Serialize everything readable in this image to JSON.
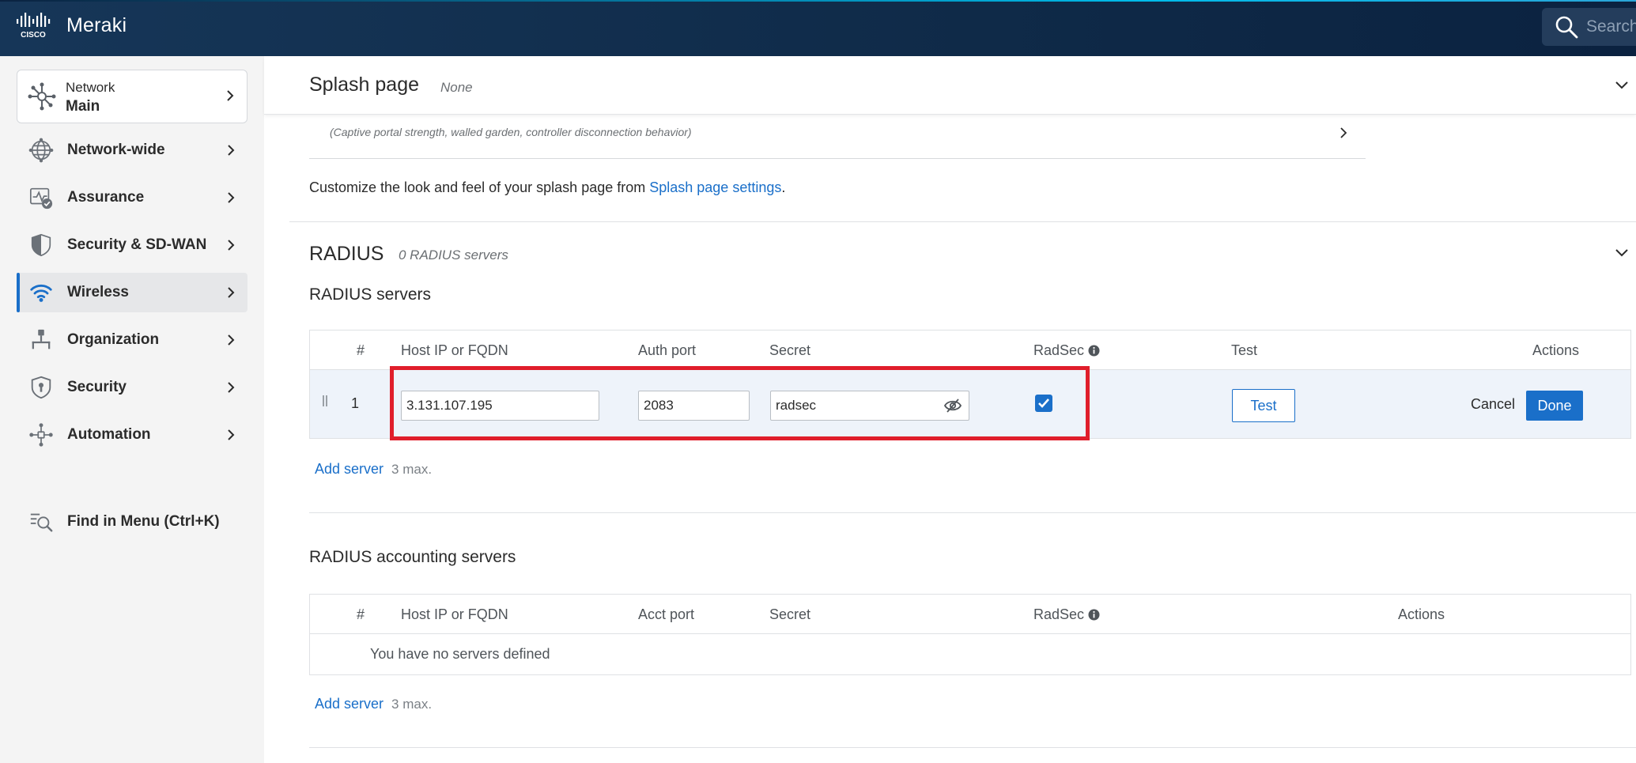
{
  "header": {
    "logo_text": "CISCO",
    "brand": "Meraki",
    "search_placeholder": "Search"
  },
  "sidebar": {
    "network_label": "Network",
    "network_name": "Main",
    "items": [
      {
        "label": "Network-wide",
        "icon": "globe-icon"
      },
      {
        "label": "Assurance",
        "icon": "assurance-icon"
      },
      {
        "label": "Security & SD-WAN",
        "icon": "shield-half-icon"
      },
      {
        "label": "Wireless",
        "icon": "wifi-icon",
        "active": true
      },
      {
        "label": "Organization",
        "icon": "organization-icon"
      },
      {
        "label": "Security",
        "icon": "shield-lock-icon"
      },
      {
        "label": "Automation",
        "icon": "automation-icon"
      }
    ],
    "find_in_menu": "Find in Menu (Ctrl+K)"
  },
  "splash": {
    "title": "Splash page",
    "value": "None",
    "advanced_desc": "(Captive portal strength, walled garden, controller disconnection behavior)",
    "customize_text": "Customize the look and feel of your splash page from ",
    "customize_link": "Splash page settings",
    "customize_end": "."
  },
  "radius": {
    "title": "RADIUS",
    "count": "0 RADIUS servers",
    "servers_title": "RADIUS servers",
    "columns": {
      "num": "#",
      "host": "Host IP or FQDN",
      "auth_port": "Auth port",
      "secret": "Secret",
      "radsec": "RadSec",
      "test": "Test",
      "actions": "Actions"
    },
    "row": {
      "num": "1",
      "host": "3.131.107.195",
      "port": "2083",
      "secret": "radsec",
      "radsec_checked": true,
      "test_label": "Test",
      "cancel_label": "Cancel",
      "done_label": "Done"
    },
    "add_server": "Add server",
    "max": "3 max."
  },
  "accounting": {
    "title": "RADIUS accounting servers",
    "columns": {
      "num": "#",
      "host": "Host IP or FQDN",
      "acct_port": "Acct port",
      "secret": "Secret",
      "radsec": "RadSec",
      "actions": "Actions"
    },
    "empty": "You have no servers defined",
    "add_server": "Add server",
    "max": "3 max."
  },
  "colors": {
    "accent": "#1a6fc9",
    "highlight": "#e01e2b",
    "header_bg": "#132f50"
  }
}
